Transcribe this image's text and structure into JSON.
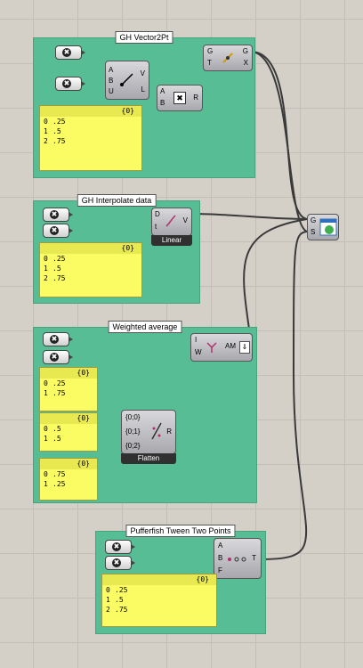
{
  "groups": [
    {
      "title": "GH Vector2Pt"
    },
    {
      "title": "GH Interpolate data"
    },
    {
      "title": "Weighted average"
    },
    {
      "title": "Pufferfish Tween Two Points"
    }
  ],
  "panels": {
    "p1": {
      "header": "{0}",
      "rows": [
        {
          "i": "0",
          "v": ".25"
        },
        {
          "i": "1",
          "v": ".5"
        },
        {
          "i": "2",
          "v": ".75"
        }
      ]
    },
    "p2": {
      "header": "{0}",
      "rows": [
        {
          "i": "0",
          "v": ".25"
        },
        {
          "i": "1",
          "v": ".5"
        },
        {
          "i": "2",
          "v": ".75"
        }
      ]
    },
    "p3": {
      "header": "{0}",
      "rows": [
        {
          "i": "0",
          "v": ".25"
        },
        {
          "i": "1",
          "v": ".75"
        }
      ]
    },
    "p4": {
      "header": "{0}",
      "rows": [
        {
          "i": "0",
          "v": ".5"
        },
        {
          "i": "1",
          "v": ".5"
        }
      ]
    },
    "p5": {
      "header": "{0}",
      "rows": [
        {
          "i": "0",
          "v": ".75"
        },
        {
          "i": "1",
          "v": ".25"
        }
      ]
    },
    "p6": {
      "header": "{0}",
      "rows": [
        {
          "i": "0",
          "v": ".25"
        },
        {
          "i": "1",
          "v": ".5"
        },
        {
          "i": "2",
          "v": ".75"
        }
      ]
    }
  },
  "components": {
    "vector2pt": {
      "in": [
        "A",
        "B",
        "U"
      ],
      "out": [
        "V",
        "L"
      ]
    },
    "multiply": {
      "in": [
        "A",
        "B"
      ],
      "out": [
        "R"
      ]
    },
    "move": {
      "in": [
        "G",
        "T"
      ],
      "out": [
        "G",
        "X"
      ]
    },
    "interpolate": {
      "in": [
        "D",
        "t"
      ],
      "out": [
        "V"
      ],
      "caption": "Linear"
    },
    "average": {
      "in": [
        "I",
        "W"
      ],
      "out": [
        "AM"
      ]
    },
    "flatten": {
      "in": [
        "{0;0}",
        "{0;1}",
        "{0;2}"
      ],
      "out": [
        "R"
      ],
      "caption": "Flatten"
    },
    "tween": {
      "in": [
        "A",
        "B",
        "F"
      ],
      "out": [
        "T"
      ]
    },
    "preview": {
      "in": [
        "G",
        "S"
      ]
    }
  },
  "icons": {
    "point": "x-point-icon",
    "preview": "preview-sphere-icon"
  },
  "colors": {
    "group": "#57bd95",
    "panel": "#fbfb64",
    "canvas": "#d4d0c8"
  }
}
